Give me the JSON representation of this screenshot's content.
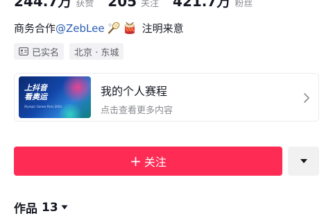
{
  "stats": [
    {
      "value": "244.7万",
      "label": "获赞"
    },
    {
      "value": "205",
      "label": "关注"
    },
    {
      "value": "421.7万",
      "label": "粉丝"
    }
  ],
  "collab": {
    "prefix": "商务合作",
    "handle": "@ZebLee",
    "suffix": "注明来意",
    "icons": [
      "badminton-racket-icon",
      "drum-icon"
    ]
  },
  "tags": [
    {
      "icon": "id-card-icon",
      "label": "已实名"
    },
    {
      "label": "北京 · 东城"
    }
  ],
  "event_card": {
    "banner_title_line1": "上抖音",
    "banner_title_line2": "看奥运",
    "banner_subtitle": "Olympic Games Paris 2024",
    "title": "我的个人赛程",
    "subtitle": "点击查看更多内容"
  },
  "actions": {
    "follow_label": "关注",
    "follow_plus": "+"
  },
  "works": {
    "label": "作品",
    "count": "13"
  },
  "colors": {
    "follow": "#fe2c55",
    "mention": "#2a5db0",
    "muted": "#8a8b91"
  }
}
